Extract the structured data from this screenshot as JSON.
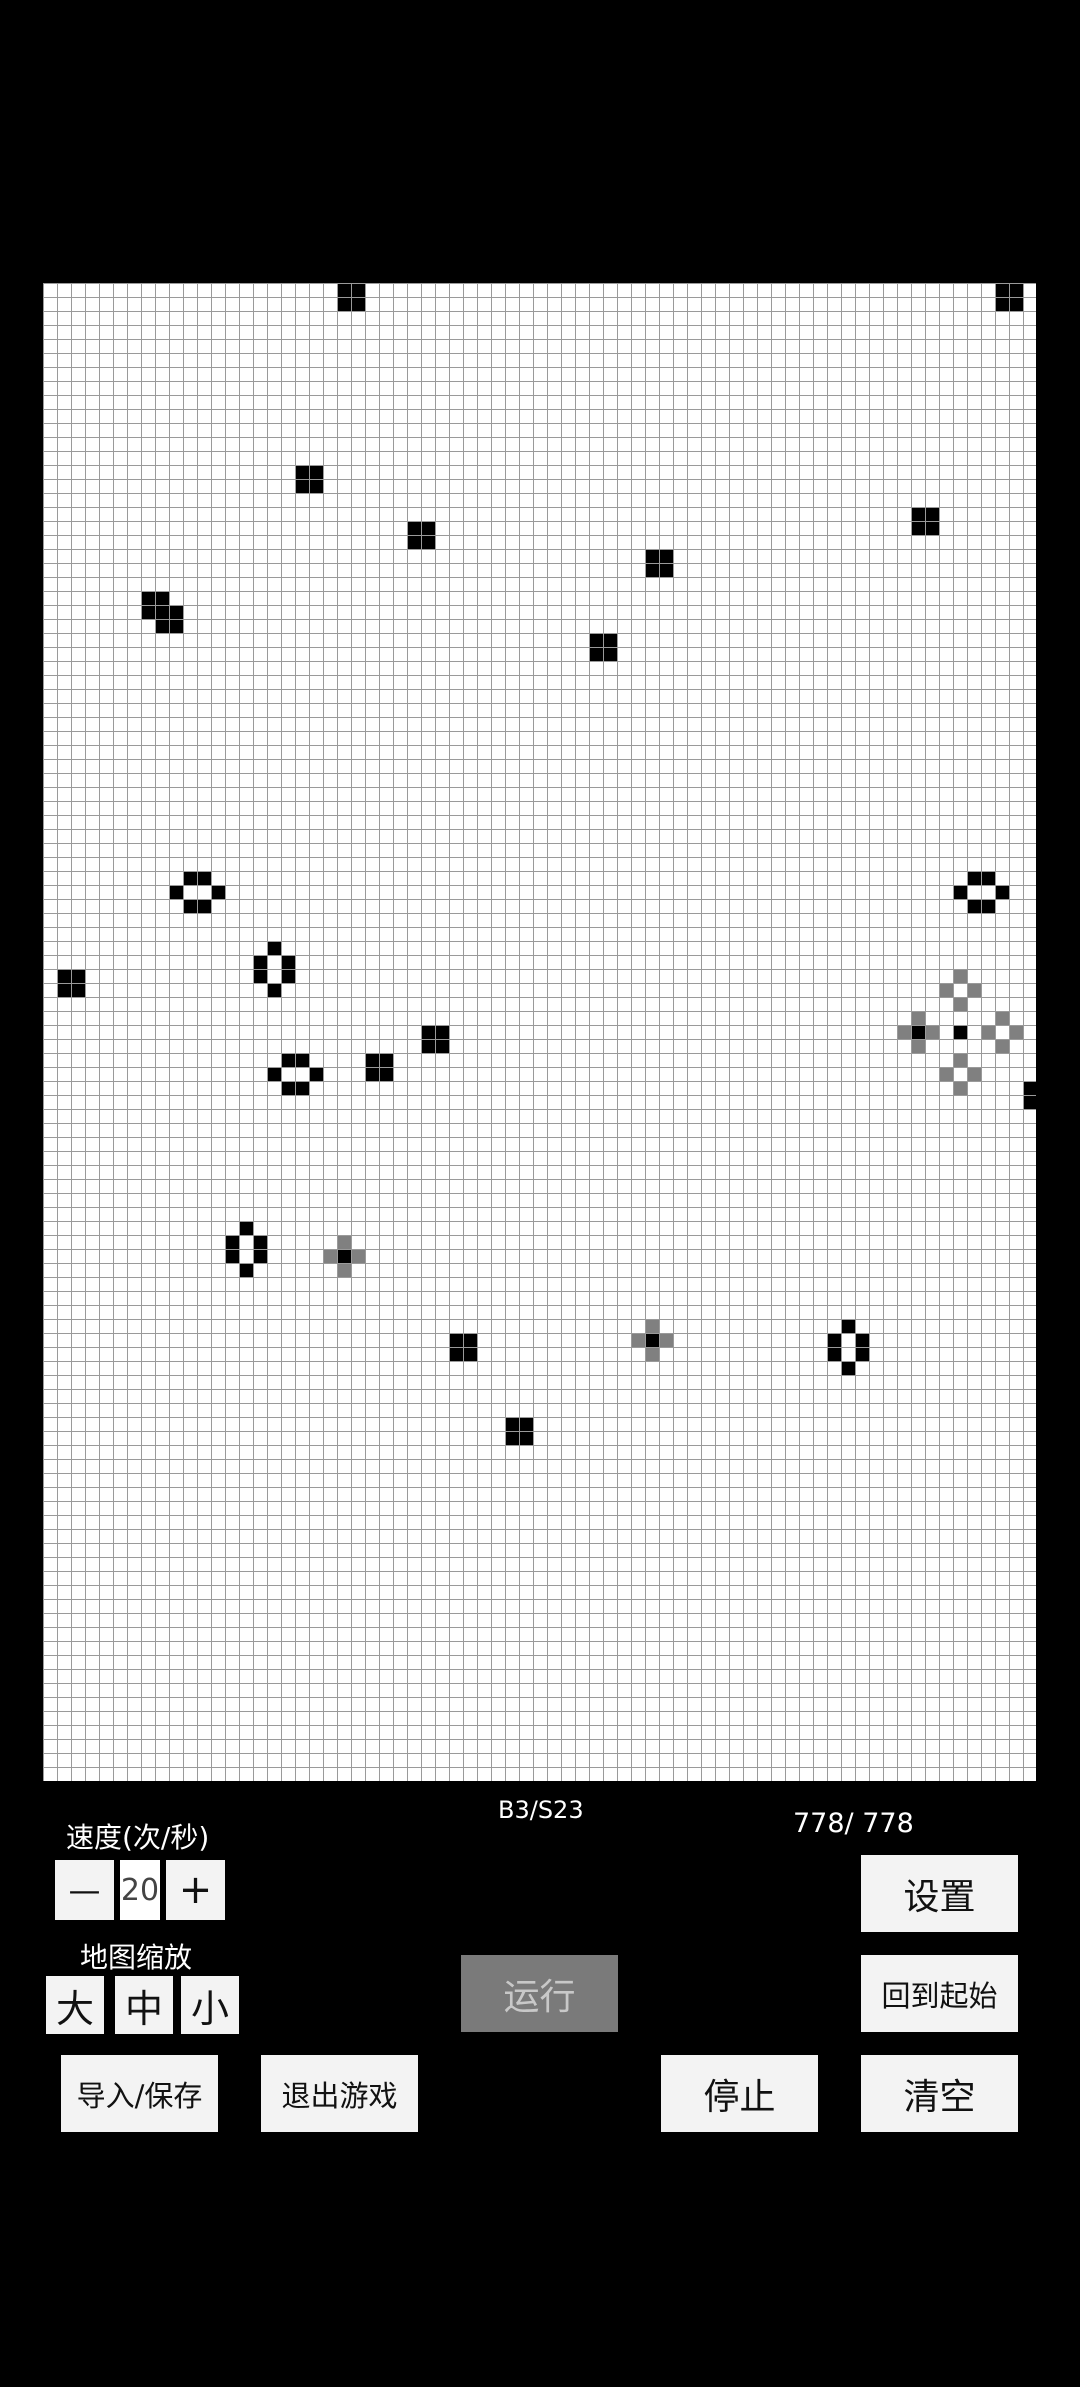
{
  "rule_label": "B3/S23",
  "counter": "778/ 778",
  "speed": {
    "label": "速度(次/秒)",
    "minus": "—",
    "value": "20",
    "plus": "+"
  },
  "zoom": {
    "label": "地图缩放",
    "large": "大",
    "medium": "中",
    "small": "小"
  },
  "buttons": {
    "settings": "设置",
    "run": "运行",
    "return_start": "回到起始",
    "import_save": "导入/保存",
    "exit_game": "退出游戏",
    "stop": "停止",
    "clear": "清空"
  },
  "colors": {
    "grid_line": "#9a9a9a",
    "cell_live": "#000000",
    "cell_ghost": "#808080",
    "button_bg": "#f3f3f3",
    "run_disabled": "#7a7a7a"
  },
  "board": {
    "cols": 71,
    "rows": 107,
    "live_cells": [
      [
        21,
        0
      ],
      [
        22,
        0
      ],
      [
        21,
        1
      ],
      [
        22,
        1
      ],
      [
        68,
        0
      ],
      [
        69,
        0
      ],
      [
        68,
        1
      ],
      [
        69,
        1
      ],
      [
        18,
        13
      ],
      [
        19,
        13
      ],
      [
        18,
        14
      ],
      [
        19,
        14
      ],
      [
        26,
        17
      ],
      [
        27,
        17
      ],
      [
        26,
        18
      ],
      [
        27,
        18
      ],
      [
        62,
        16
      ],
      [
        63,
        16
      ],
      [
        62,
        17
      ],
      [
        63,
        17
      ],
      [
        43,
        19
      ],
      [
        44,
        19
      ],
      [
        43,
        20
      ],
      [
        44,
        20
      ],
      [
        7,
        22
      ],
      [
        8,
        22
      ],
      [
        8,
        23
      ],
      [
        9,
        23
      ],
      [
        7,
        23
      ],
      [
        9,
        24
      ],
      [
        8,
        24
      ],
      [
        39,
        25
      ],
      [
        40,
        25
      ],
      [
        39,
        26
      ],
      [
        40,
        26
      ],
      [
        10,
        42
      ],
      [
        11,
        42
      ],
      [
        9,
        43
      ],
      [
        12,
        43
      ],
      [
        10,
        44
      ],
      [
        11,
        44
      ],
      [
        66,
        42
      ],
      [
        67,
        42
      ],
      [
        65,
        43
      ],
      [
        68,
        43
      ],
      [
        66,
        44
      ],
      [
        67,
        44
      ],
      [
        1,
        49
      ],
      [
        2,
        49
      ],
      [
        1,
        50
      ],
      [
        2,
        50
      ],
      [
        16,
        47
      ],
      [
        15,
        48
      ],
      [
        17,
        48
      ],
      [
        15,
        49
      ],
      [
        17,
        49
      ],
      [
        16,
        50
      ],
      [
        27,
        53
      ],
      [
        28,
        53
      ],
      [
        27,
        54
      ],
      [
        28,
        54
      ],
      [
        62,
        53
      ],
      [
        65,
        53
      ],
      [
        17,
        55
      ],
      [
        18,
        55
      ],
      [
        16,
        56
      ],
      [
        19,
        56
      ],
      [
        17,
        57
      ],
      [
        18,
        57
      ],
      [
        23,
        55
      ],
      [
        24,
        55
      ],
      [
        23,
        56
      ],
      [
        24,
        56
      ],
      [
        70,
        57
      ],
      [
        71,
        57
      ],
      [
        70,
        58
      ],
      [
        71,
        58
      ],
      [
        14,
        67
      ],
      [
        13,
        68
      ],
      [
        15,
        68
      ],
      [
        13,
        69
      ],
      [
        15,
        69
      ],
      [
        14,
        70
      ],
      [
        21,
        69
      ],
      [
        29,
        75
      ],
      [
        30,
        75
      ],
      [
        29,
        76
      ],
      [
        30,
        76
      ],
      [
        43,
        75
      ],
      [
        57,
        74
      ],
      [
        56,
        75
      ],
      [
        58,
        75
      ],
      [
        56,
        76
      ],
      [
        58,
        76
      ],
      [
        57,
        77
      ],
      [
        33,
        81
      ],
      [
        34,
        81
      ],
      [
        33,
        82
      ],
      [
        34,
        82
      ]
    ],
    "ghost_cells": [
      [
        65,
        49
      ],
      [
        64,
        50
      ],
      [
        66,
        50
      ],
      [
        65,
        51
      ],
      [
        62,
        52
      ],
      [
        61,
        53
      ],
      [
        63,
        53
      ],
      [
        62,
        54
      ],
      [
        68,
        52
      ],
      [
        67,
        53
      ],
      [
        69,
        53
      ],
      [
        68,
        54
      ],
      [
        65,
        55
      ],
      [
        64,
        56
      ],
      [
        66,
        56
      ],
      [
        65,
        57
      ],
      [
        21,
        68
      ],
      [
        20,
        69
      ],
      [
        22,
        69
      ],
      [
        21,
        70
      ],
      [
        43,
        74
      ],
      [
        42,
        75
      ],
      [
        44,
        75
      ],
      [
        43,
        76
      ]
    ]
  }
}
